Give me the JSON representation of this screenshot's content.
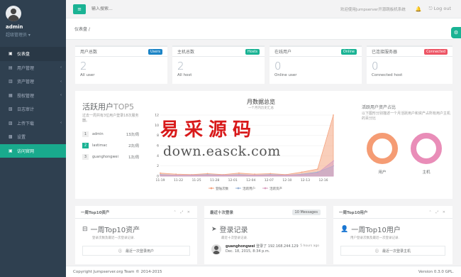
{
  "user": {
    "name": "admin",
    "role": "超级管理员 ▾"
  },
  "sidebar": {
    "items": [
      {
        "icon": "▣",
        "label": "仪表盘"
      },
      {
        "icon": "▤",
        "label": "用户管理"
      },
      {
        "icon": "▥",
        "label": "资产管理"
      },
      {
        "icon": "▦",
        "label": "授权管理"
      },
      {
        "icon": "▧",
        "label": "日志审计"
      },
      {
        "icon": "▨",
        "label": "上传下载"
      },
      {
        "icon": "▩",
        "label": "设置"
      },
      {
        "icon": "▣",
        "label": "访问官网"
      }
    ]
  },
  "topbar": {
    "menu_icon": "≡",
    "search_placeholder": "输入搜索...",
    "welcome": "欢迎使用Jumpserver开源跳板机系统",
    "bell": "🔔",
    "logout": "⎋  Log out"
  },
  "breadcrumb": "仪表盘  /",
  "stats": [
    {
      "title": "用户总数",
      "badge": "Users",
      "badge_color": "#1c84c6",
      "value": "2",
      "sub": "All user"
    },
    {
      "title": "主机总数",
      "badge": "Hosts",
      "badge_color": "#1ab394",
      "value": "2",
      "sub": "All host"
    },
    {
      "title": "在线用户",
      "badge": "Online",
      "badge_color": "#1ab394",
      "value": "0",
      "sub": "Online user"
    },
    {
      "title": "已连接服务器",
      "badge": "Connected",
      "badge_color": "#ed5565",
      "value": "0",
      "sub": "Connected host"
    }
  ],
  "top5": {
    "title_main": "活跃用户",
    "title_light": "TOP5",
    "desc": "过去一周共有3位用户登录18次服务器。",
    "rows": [
      {
        "rank": "1",
        "name": "admin",
        "count": "13次/周"
      },
      {
        "rank": "2",
        "name": "lastimac",
        "count": "2次/周"
      },
      {
        "rank": "3",
        "name": "guanghongwei",
        "count": "1次/周"
      }
    ]
  },
  "chart_data": {
    "type": "area",
    "title": "月数据总览",
    "subtitle": "一个月内历史汇总",
    "x": [
      "11-19",
      "11-22",
      "11-25",
      "11-28",
      "12-01",
      "12-04",
      "12-07",
      "12-10",
      "12-13",
      "12-16"
    ],
    "yticks": [
      "0",
      "2",
      "4",
      "6",
      "8",
      "10",
      "12"
    ],
    "ylim": [
      0,
      12
    ],
    "series": [
      {
        "name": "登陆次数",
        "color": "#f4a582",
        "values": [
          0.6,
          0.4,
          0.3,
          0.5,
          0.3,
          0.6,
          0.4,
          0.5,
          0.3,
          0.8,
          1.4,
          12
        ]
      },
      {
        "name": "活跃用户",
        "color": "#9ab3d5",
        "values": [
          0.3,
          0.2,
          0.2,
          0.3,
          0.2,
          0.3,
          0.2,
          0.3,
          0.2,
          0.4,
          0.8,
          2
        ]
      },
      {
        "name": "活跃资产",
        "color": "#d9a0c0",
        "values": [
          0.2,
          0.2,
          0.2,
          0.2,
          0.2,
          0.2,
          0.2,
          0.2,
          0.2,
          0.3,
          0.6,
          3
        ]
      }
    ],
    "legend": "bottom"
  },
  "ratio": {
    "title": "活跃用户资产占比",
    "desc": "以下图形分别描述一个月活跃用户和资产占所有用户主机的百分比",
    "donuts": [
      {
        "label": "用户",
        "percent": 100,
        "color": "#f59c74"
      },
      {
        "label": "主机",
        "percent": 100,
        "color": "#e98db8"
      }
    ]
  },
  "watermark": {
    "cn": "易采源码",
    "url": "down.easck.com"
  },
  "panels": {
    "assets": {
      "header": "一周Top10资产",
      "tools": "⌃ ⤢ ✕",
      "icon": "⊟",
      "title": "一周Top10资产",
      "desc": "登录次数及最近一次登录记录.",
      "empty_icon": "ⓘ",
      "empty": "最近一次登录用户"
    },
    "logins": {
      "header": "最近十次登录",
      "tag": "10 Messages",
      "icon": "➤",
      "title": "登录记录",
      "desc": "最近十次登录记录.",
      "user": "guanghongwei",
      "text": " 登录了 192.168.244.129",
      "date": "Dec. 18, 2015, 8:34 p.m.",
      "time": "5 hours ago"
    },
    "users": {
      "header": "一周Top10用户",
      "tools": "⌃ ⤢ ✕",
      "icon": "👤",
      "title": "一周Top10用户",
      "desc": "用户登录次数及最近一次登录记录.",
      "empty_icon": "ⓘ",
      "empty": "最近一次登录主机"
    }
  },
  "footer": {
    "copyright": "Copyright Jumpserver.org Team © 2014-2015",
    "version": "Version 0.3.0 GPL."
  }
}
